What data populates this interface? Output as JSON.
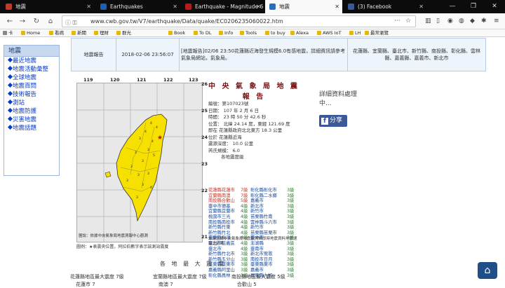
{
  "tabs": [
    {
      "title": "地震",
      "color": "#c0392b"
    },
    {
      "title": "Earthquakes",
      "color": "#1a5fb4"
    },
    {
      "title": "Earthquake - Magnitude 6",
      "color": "#b71c1c"
    },
    {
      "title": "地震",
      "color": "#2a6ebb"
    },
    {
      "title": "(3) Facebook",
      "color": "#3b5998"
    }
  ],
  "window_controls": [
    "—",
    "❐",
    "✕"
  ],
  "url": "www.cwb.gov.tw/V7/earthquake/Data/quake/EC0206235060022.htm",
  "bookmarks": [
    "卡",
    "Home",
    "看病",
    "新聞",
    "理財",
    "群光",
    "Book",
    "To DL",
    "Info",
    "Tools",
    "to buy",
    "Alexa",
    "AWS IoT",
    "LH",
    "最常瀏覽"
  ],
  "sidebar": {
    "header": "地震",
    "items": [
      "最近地震",
      "地震活動彙整",
      "全球地震",
      "地震百問",
      "技術報告",
      "測站",
      "地震防護",
      "災害地震",
      "地震話題"
    ]
  },
  "top_table": {
    "type": "地震報告",
    "time": "2018-02-06 23:56:07",
    "message": "[地震報告]02/06 23:50花蓮縣近海發生規模6.0有感地震，詳細資訊請參考氣象局網站，氣象局。",
    "areas": "花蓮縣、宜蘭縣、臺北市、新竹縣、南投縣、彰化縣、雲林縣、嘉義縣、嘉義市、新北市"
  },
  "report": {
    "title": "中 央 氣 象 局 地 震 報 告",
    "number": "編號：第107023號",
    "date": "日期： 107 年 2 月 6 日",
    "time": "時間： 23 時 50 分 42.6 秒",
    "location": "位置： 北緯 24.14 度，東經 121.69 度",
    "location2": "即在 花蓮縣政府北北東方 18.3 公里",
    "region": "位於 花蓮縣近海",
    "depth": "震源深度：  10.0 公里",
    "magnitude": "芮氏規模：  6.0",
    "intensity_header": "各地震度級",
    "intensities": [
      [
        "花蓮縣花蓮市",
        "7級",
        "彰化縣彰化市",
        "3級"
      ],
      [
        "宜蘭縣南澳",
        "7級",
        "彰化縣二水鄉",
        "3級"
      ],
      [
        "南投縣合歡山",
        "5級",
        "嘉義市",
        "3級"
      ],
      [
        "臺中市德基",
        "4級",
        "新北市",
        "3級"
      ],
      [
        "宜蘭縣宜蘭市",
        "4級",
        "新竹市",
        "3級"
      ],
      [
        "桃園市三光",
        "4級",
        "苗栗縣竹南",
        "3級"
      ],
      [
        "南投縣南投市",
        "4級",
        "雲林縣斗六市",
        "3級"
      ],
      [
        "新竹縣竹東",
        "4級",
        "新竹市",
        "3級"
      ],
      [
        "新竹縣竹北",
        "4級",
        "苗栗縣苗栗市",
        "3級"
      ],
      [
        "臺東縣長濱",
        "4級",
        "臺中市",
        "3級"
      ],
      [
        "臺北市信義區",
        "4級",
        "澎湖縣",
        "3級"
      ],
      [
        "臺北市",
        "4級",
        "臺南市",
        "3級"
      ],
      [
        "新竹縣竹北市",
        "3級",
        "新北市鶯歌",
        "3級"
      ],
      [
        "新竹縣五分山",
        "3級",
        "南投市日月",
        "3級"
      ],
      [
        "臺東縣臺東市",
        "3級",
        "臺東縣東市",
        "3級"
      ],
      [
        "嘉義縣阿里山",
        "3級",
        "嘉義市",
        "3級"
      ],
      [
        "彰化縣員林",
        "3級",
        "屏東縣九如",
        "3級"
      ]
    ],
    "footnote": "本報告係中央氣象局地震觀測網即時地震資料地震速報之結果。"
  },
  "map": {
    "longitudes": [
      "119",
      "120",
      "121",
      "122",
      "123"
    ],
    "latitudes": [
      "26",
      "25",
      "24",
      "23",
      "22",
      "21"
    ],
    "credit": "圖說：依據中央氣象局地震測報中心觀測",
    "legend": "圖例：★表震央位置，阿拉伯數字表示該測站震度"
  },
  "detail": {
    "line1": "詳細資料處理",
    "line2": "中..."
  },
  "share_label": "分享",
  "section_title": "各 地 最 大 震 度",
  "bottom": [
    "花蓮縣地區最大震度  7級",
    "宜蘭縣地區最大震度  7級",
    "南投縣地區最大震度  5級"
  ],
  "bottom2": [
    "花蓮市  7",
    "南澳  7",
    "合歡山  5"
  ]
}
